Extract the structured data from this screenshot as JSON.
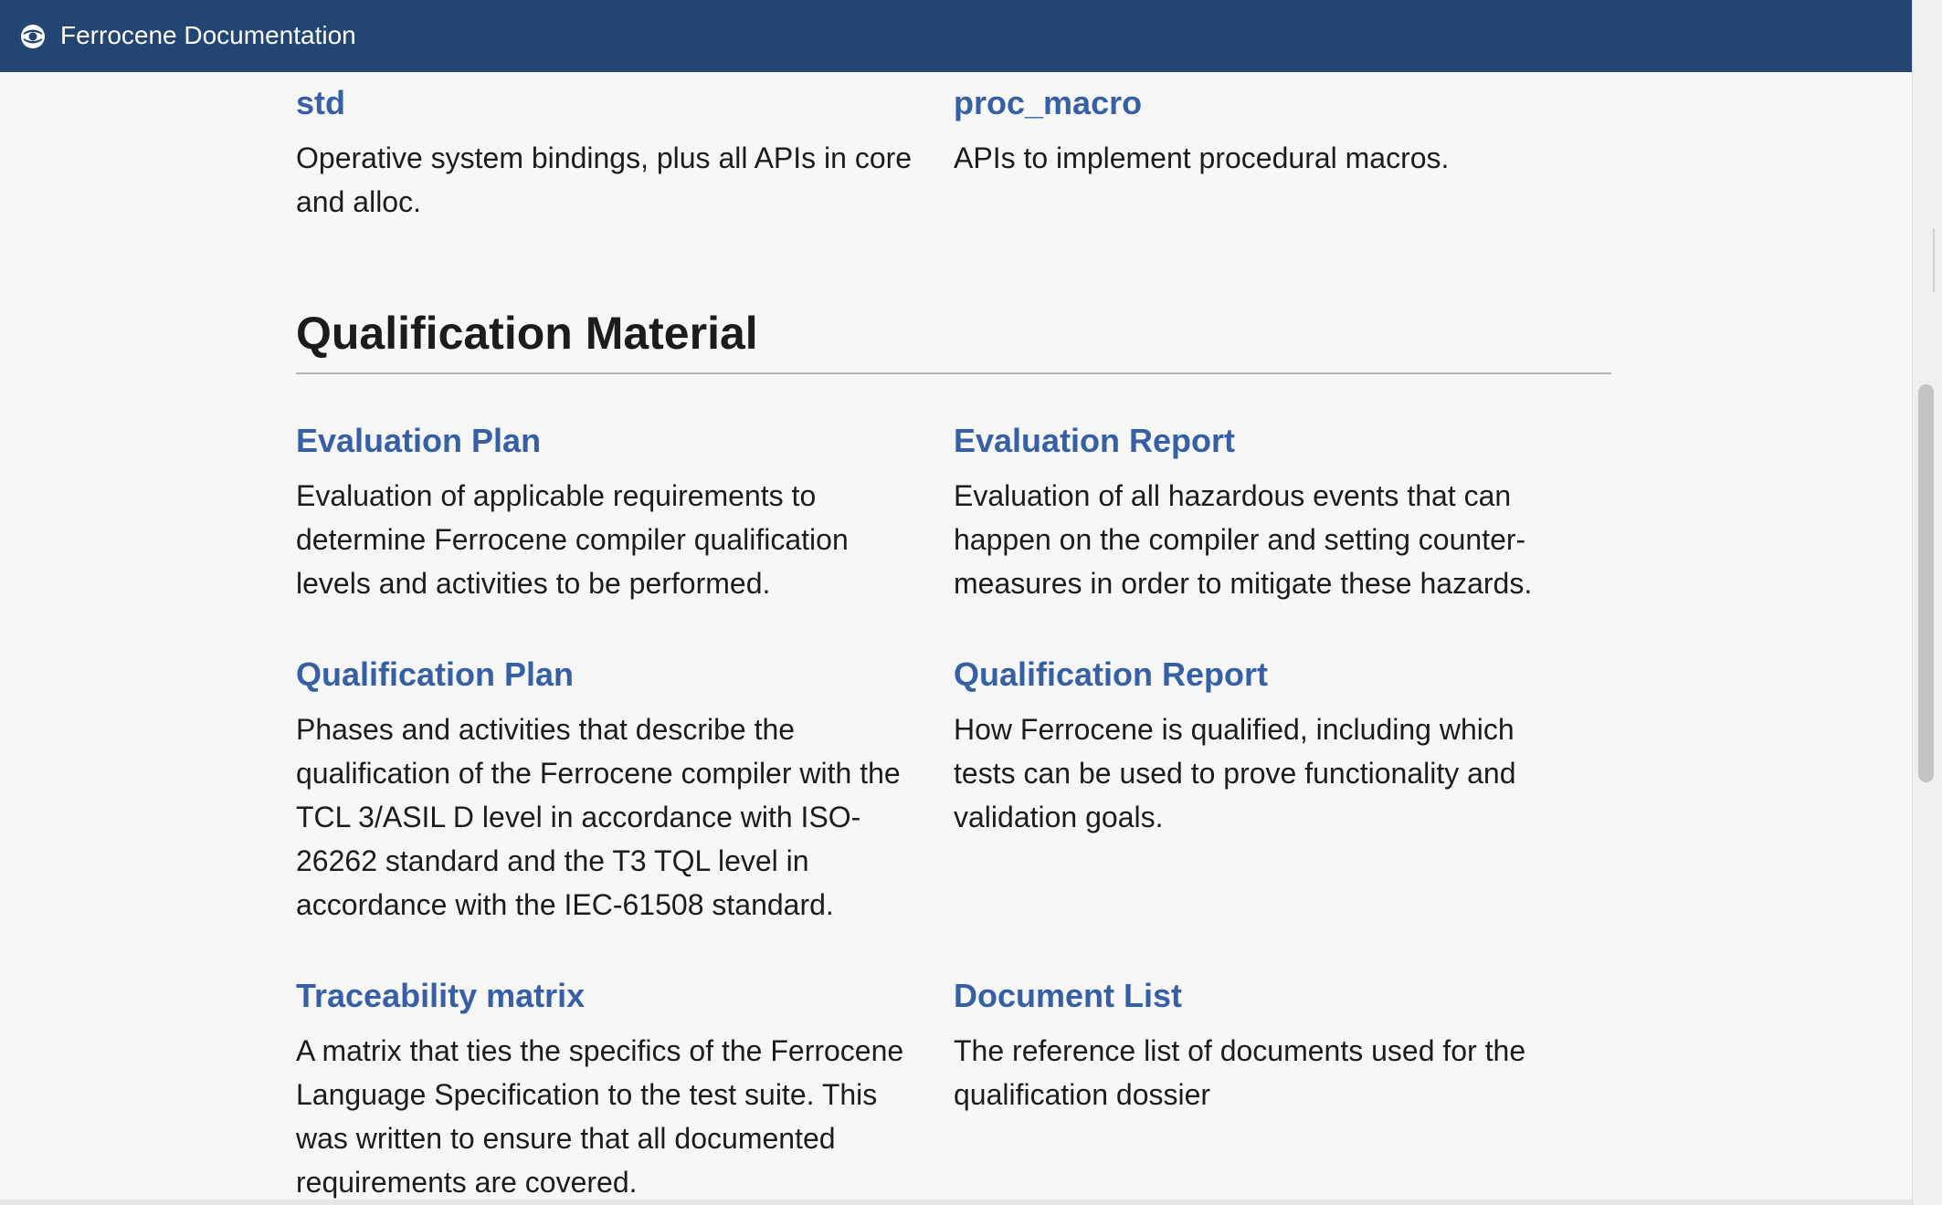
{
  "header": {
    "title": "Ferrocene Documentation",
    "logo_icon": "ferrocene-logo-icon",
    "background_color": "#234574"
  },
  "top_cards": [
    {
      "title": "std",
      "description": "Operative system bindings, plus all APIs in core and alloc."
    },
    {
      "title": "proc_macro",
      "description": "APIs to implement procedural macros."
    }
  ],
  "qualification": {
    "heading": "Qualification Material",
    "cards": [
      {
        "title": "Evaluation Plan",
        "description": "Evaluation of applicable requirements to determine Ferrocene compiler qualification levels and activities to be performed."
      },
      {
        "title": "Evaluation Report",
        "description": "Evaluation of all hazardous events that can happen on the compiler and setting counter-measures in order to mitigate these hazards."
      },
      {
        "title": "Qualification Plan",
        "description": "Phases and activities that describe the qualification of the Ferrocene compiler with the TCL 3/ASIL D level in accordance with ISO-26262 standard and the T3 TQL level in accordance with the IEC-61508 standard."
      },
      {
        "title": "Qualification Report",
        "description": "How Ferrocene is qualified, including which tests can be used to prove functionality and validation goals."
      },
      {
        "title": "Traceability matrix",
        "description": "A matrix that ties the specifics of the Ferrocene Language Specification to the test suite. This was written to ensure that all documented requirements are covered."
      },
      {
        "title": "Document List",
        "description": "The reference list of documents used for the qualification dossier"
      }
    ]
  },
  "colors": {
    "link": "#3560a6",
    "text": "#1c1c1c",
    "background": "#f7f7f7"
  }
}
